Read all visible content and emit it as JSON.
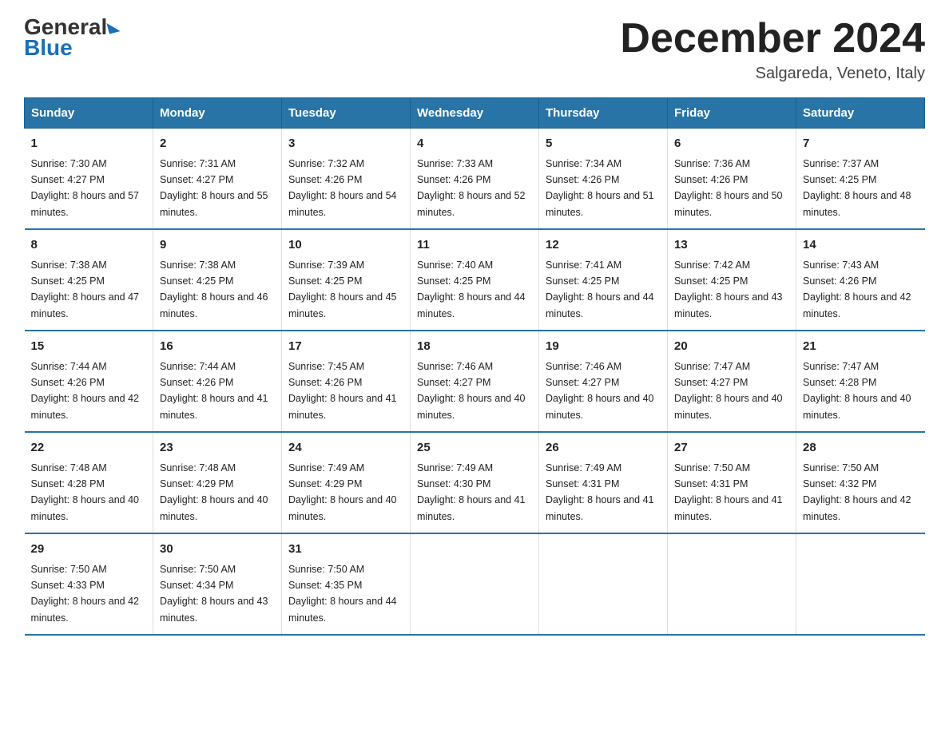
{
  "header": {
    "logo_general": "General",
    "logo_blue": "Blue",
    "title": "December 2024",
    "location": "Salgareda, Veneto, Italy"
  },
  "days_of_week": [
    "Sunday",
    "Monday",
    "Tuesday",
    "Wednesday",
    "Thursday",
    "Friday",
    "Saturday"
  ],
  "weeks": [
    [
      {
        "day": "1",
        "sunrise": "7:30 AM",
        "sunset": "4:27 PM",
        "daylight": "8 hours and 57 minutes."
      },
      {
        "day": "2",
        "sunrise": "7:31 AM",
        "sunset": "4:27 PM",
        "daylight": "8 hours and 55 minutes."
      },
      {
        "day": "3",
        "sunrise": "7:32 AM",
        "sunset": "4:26 PM",
        "daylight": "8 hours and 54 minutes."
      },
      {
        "day": "4",
        "sunrise": "7:33 AM",
        "sunset": "4:26 PM",
        "daylight": "8 hours and 52 minutes."
      },
      {
        "day": "5",
        "sunrise": "7:34 AM",
        "sunset": "4:26 PM",
        "daylight": "8 hours and 51 minutes."
      },
      {
        "day": "6",
        "sunrise": "7:36 AM",
        "sunset": "4:26 PM",
        "daylight": "8 hours and 50 minutes."
      },
      {
        "day": "7",
        "sunrise": "7:37 AM",
        "sunset": "4:25 PM",
        "daylight": "8 hours and 48 minutes."
      }
    ],
    [
      {
        "day": "8",
        "sunrise": "7:38 AM",
        "sunset": "4:25 PM",
        "daylight": "8 hours and 47 minutes."
      },
      {
        "day": "9",
        "sunrise": "7:38 AM",
        "sunset": "4:25 PM",
        "daylight": "8 hours and 46 minutes."
      },
      {
        "day": "10",
        "sunrise": "7:39 AM",
        "sunset": "4:25 PM",
        "daylight": "8 hours and 45 minutes."
      },
      {
        "day": "11",
        "sunrise": "7:40 AM",
        "sunset": "4:25 PM",
        "daylight": "8 hours and 44 minutes."
      },
      {
        "day": "12",
        "sunrise": "7:41 AM",
        "sunset": "4:25 PM",
        "daylight": "8 hours and 44 minutes."
      },
      {
        "day": "13",
        "sunrise": "7:42 AM",
        "sunset": "4:25 PM",
        "daylight": "8 hours and 43 minutes."
      },
      {
        "day": "14",
        "sunrise": "7:43 AM",
        "sunset": "4:26 PM",
        "daylight": "8 hours and 42 minutes."
      }
    ],
    [
      {
        "day": "15",
        "sunrise": "7:44 AM",
        "sunset": "4:26 PM",
        "daylight": "8 hours and 42 minutes."
      },
      {
        "day": "16",
        "sunrise": "7:44 AM",
        "sunset": "4:26 PM",
        "daylight": "8 hours and 41 minutes."
      },
      {
        "day": "17",
        "sunrise": "7:45 AM",
        "sunset": "4:26 PM",
        "daylight": "8 hours and 41 minutes."
      },
      {
        "day": "18",
        "sunrise": "7:46 AM",
        "sunset": "4:27 PM",
        "daylight": "8 hours and 40 minutes."
      },
      {
        "day": "19",
        "sunrise": "7:46 AM",
        "sunset": "4:27 PM",
        "daylight": "8 hours and 40 minutes."
      },
      {
        "day": "20",
        "sunrise": "7:47 AM",
        "sunset": "4:27 PM",
        "daylight": "8 hours and 40 minutes."
      },
      {
        "day": "21",
        "sunrise": "7:47 AM",
        "sunset": "4:28 PM",
        "daylight": "8 hours and 40 minutes."
      }
    ],
    [
      {
        "day": "22",
        "sunrise": "7:48 AM",
        "sunset": "4:28 PM",
        "daylight": "8 hours and 40 minutes."
      },
      {
        "day": "23",
        "sunrise": "7:48 AM",
        "sunset": "4:29 PM",
        "daylight": "8 hours and 40 minutes."
      },
      {
        "day": "24",
        "sunrise": "7:49 AM",
        "sunset": "4:29 PM",
        "daylight": "8 hours and 40 minutes."
      },
      {
        "day": "25",
        "sunrise": "7:49 AM",
        "sunset": "4:30 PM",
        "daylight": "8 hours and 41 minutes."
      },
      {
        "day": "26",
        "sunrise": "7:49 AM",
        "sunset": "4:31 PM",
        "daylight": "8 hours and 41 minutes."
      },
      {
        "day": "27",
        "sunrise": "7:50 AM",
        "sunset": "4:31 PM",
        "daylight": "8 hours and 41 minutes."
      },
      {
        "day": "28",
        "sunrise": "7:50 AM",
        "sunset": "4:32 PM",
        "daylight": "8 hours and 42 minutes."
      }
    ],
    [
      {
        "day": "29",
        "sunrise": "7:50 AM",
        "sunset": "4:33 PM",
        "daylight": "8 hours and 42 minutes."
      },
      {
        "day": "30",
        "sunrise": "7:50 AM",
        "sunset": "4:34 PM",
        "daylight": "8 hours and 43 minutes."
      },
      {
        "day": "31",
        "sunrise": "7:50 AM",
        "sunset": "4:35 PM",
        "daylight": "8 hours and 44 minutes."
      },
      null,
      null,
      null,
      null
    ]
  ]
}
